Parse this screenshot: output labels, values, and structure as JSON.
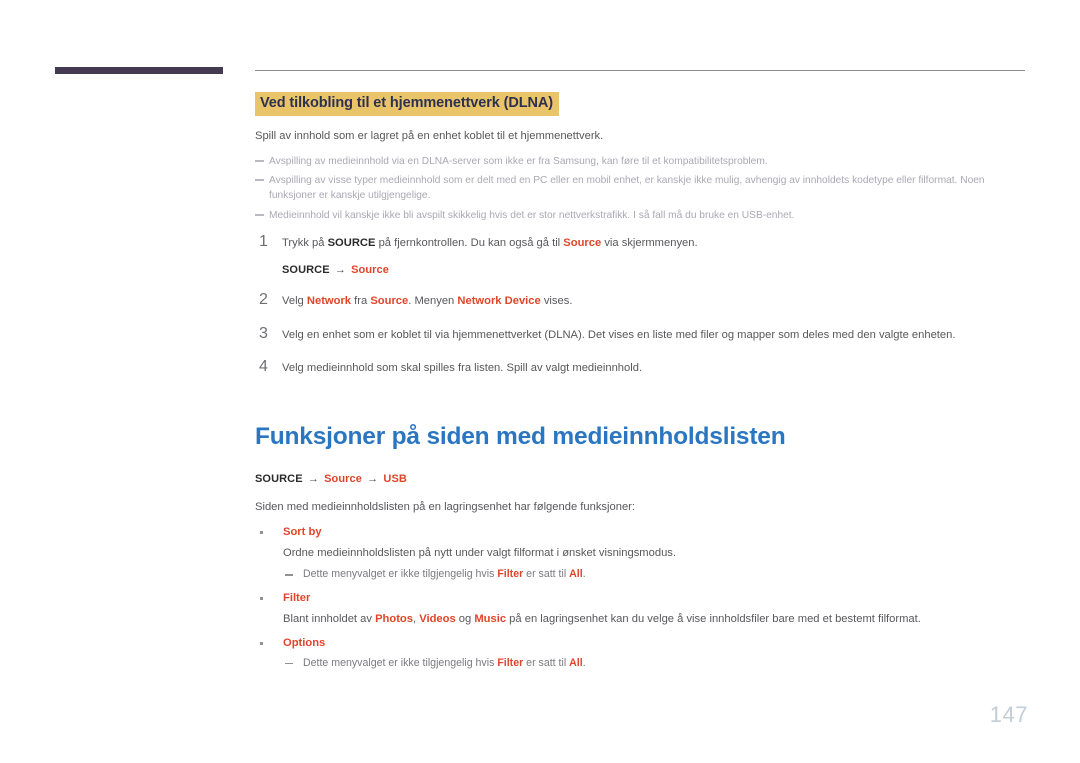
{
  "page": {
    "number": "147",
    "colors": {
      "heading_blue": "#2b76c0",
      "highlight_amber": "#e9c469",
      "keyword_orange": "#e0452a",
      "deco_bar": "#443a52",
      "page_number": "#c3cdd6"
    }
  },
  "section_dlna": {
    "heading": "Ved tilkobling til et hjemmenettverk (DLNA)",
    "intro": "Spill av innhold som er lagret på en enhet koblet til et hjemmenettverk.",
    "notes": [
      "Avspilling av medieinnhold via en DLNA-server som ikke er fra Samsung, kan føre til et kompatibilitetsproblem.",
      "Avspilling av visse typer medieinnhold som er delt med en PC eller en mobil enhet, er kanskje ikke mulig, avhengig av innholdets kodetype eller filformat. Noen funksjoner er kanskje utilgjengelige.",
      "Medieinnhold vil kanskje ikke bli avspilt skikkelig hvis det er stor nettverkstrafikk. I så fall må du bruke en USB-enhet."
    ],
    "steps": [
      {
        "number": "1",
        "parts": [
          {
            "t": "Trykk på ",
            "s": "plain"
          },
          {
            "t": "SOURCE",
            "s": "bold-dark"
          },
          {
            "t": " på fjernkontrollen. Du kan også gå til ",
            "s": "plain"
          },
          {
            "t": "Source",
            "s": "keyword"
          },
          {
            "t": " via skjermmenyen.",
            "s": "plain"
          }
        ],
        "path": {
          "root": "SOURCE",
          "arrow": "→",
          "items": [
            "Source"
          ]
        }
      },
      {
        "number": "2",
        "parts": [
          {
            "t": "Velg ",
            "s": "plain"
          },
          {
            "t": "Network",
            "s": "keyword"
          },
          {
            "t": " fra ",
            "s": "plain"
          },
          {
            "t": "Source",
            "s": "keyword"
          },
          {
            "t": ". Menyen ",
            "s": "plain"
          },
          {
            "t": "Network Device",
            "s": "keyword"
          },
          {
            "t": " vises.",
            "s": "plain"
          }
        ]
      },
      {
        "number": "3",
        "parts": [
          {
            "t": "Velg en enhet som er koblet til via hjemmenettverket (DLNA). Det vises en liste med filer og mapper som deles med den valgte enheten.",
            "s": "plain"
          }
        ]
      },
      {
        "number": "4",
        "parts": [
          {
            "t": "Velg medieinnhold som skal spilles fra listen. Spill av valgt medieinnhold.",
            "s": "plain"
          }
        ]
      }
    ]
  },
  "section_medialist": {
    "heading": "Funksjoner på siden med medieinnholdslisten",
    "path": {
      "root": "SOURCE",
      "arrow": "→",
      "items": [
        "Source",
        "USB"
      ]
    },
    "intro": "Siden med medieinnholdslisten på en lagringsenhet har følgende funksjoner:",
    "features": [
      {
        "title": "Sort by",
        "desc": "Ordne medieinnholdslisten på nytt under valgt filformat i ønsket visningsmodus.",
        "subs": [
          [
            {
              "t": "Dette menyvalget er ikke tilgjengelig hvis ",
              "s": "plain"
            },
            {
              "t": "Filter",
              "s": "keyword"
            },
            {
              "t": " er satt til ",
              "s": "plain"
            },
            {
              "t": "All",
              "s": "keyword"
            },
            {
              "t": ".",
              "s": "plain"
            }
          ]
        ]
      },
      {
        "title": "Filter",
        "desc_parts": [
          {
            "t": "Blant innholdet av ",
            "s": "plain"
          },
          {
            "t": "Photos",
            "s": "keyword"
          },
          {
            "t": ", ",
            "s": "plain"
          },
          {
            "t": "Videos",
            "s": "keyword"
          },
          {
            "t": " og ",
            "s": "plain"
          },
          {
            "t": "Music",
            "s": "keyword"
          },
          {
            "t": " på en lagringsenhet kan du velge å vise innholdsfiler bare med et bestemt filformat.",
            "s": "plain"
          }
        ],
        "subs": []
      },
      {
        "title": "Options",
        "subs": [
          [
            {
              "t": "Dette menyvalget er ikke tilgjengelig hvis ",
              "s": "plain"
            },
            {
              "t": "Filter",
              "s": "keyword"
            },
            {
              "t": " er satt til ",
              "s": "plain"
            },
            {
              "t": "All",
              "s": "keyword"
            },
            {
              "t": ".",
              "s": "plain"
            }
          ]
        ]
      }
    ]
  }
}
